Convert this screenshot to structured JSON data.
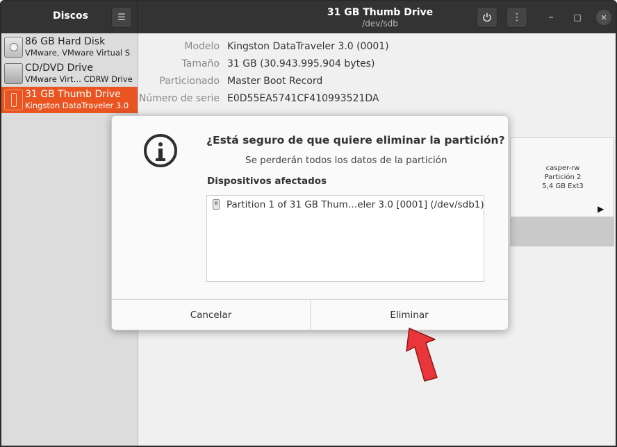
{
  "sidebar": {
    "title": "Discos",
    "menu_icon": "hamburger-menu-icon",
    "items": [
      {
        "name": "86 GB Hard Disk",
        "sub": "VMware, VMware Virtual S",
        "icon": "hard-disk-icon"
      },
      {
        "name": "CD/DVD Drive",
        "sub": "VMware Virt… CDRW Drive",
        "icon": "cd-drive-icon"
      },
      {
        "name": "31 GB Thumb Drive",
        "sub": "Kingston DataTraveler 3.0",
        "icon": "usb-drive-icon",
        "selected": true
      }
    ]
  },
  "header": {
    "title": "31 GB Thumb Drive",
    "subtitle": "/dev/sdb",
    "power_icon": "power-icon",
    "menu_icon": "vertical-dots-icon",
    "minimize": "–",
    "maximize": "□",
    "close": "✕"
  },
  "info": [
    {
      "label": "Modelo",
      "value": "Kingston DataTraveler 3.0 (0001)"
    },
    {
      "label": "Tamaño",
      "value": "31 GB (30.943.995.904 bytes)"
    },
    {
      "label": "Particionado",
      "value": "Master Boot Record"
    },
    {
      "label": "Número de serie",
      "value": "E0D55EA5741CF410993521DA"
    }
  ],
  "partition": {
    "name": "casper-rw",
    "label": "Partición 2",
    "size": "5,4 GB Ext3"
  },
  "dialog": {
    "title": "¿Está seguro de que quiere eliminar la partición?",
    "subtitle": "Se perderán todos los datos de la partición",
    "section": "Dispositivos afectados",
    "devices": [
      "Partition 1 of 31 GB Thum…eler 3.0 [0001] (/dev/sdb1)"
    ],
    "cancel_label": "Cancelar",
    "delete_label": "Eliminar"
  },
  "colors": {
    "accent": "#e95420",
    "arrow": "#e8363a"
  }
}
